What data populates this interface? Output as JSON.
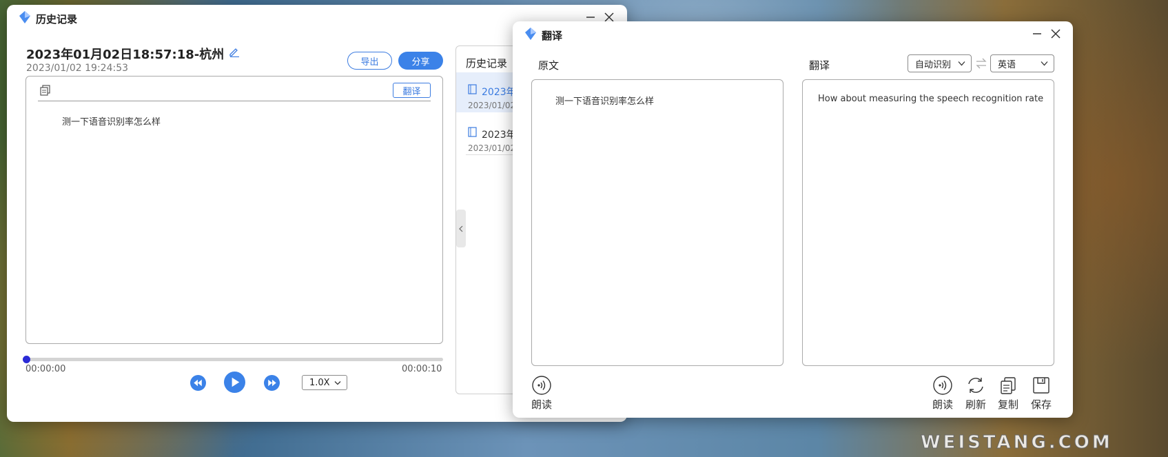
{
  "history_window": {
    "title": "历史记录",
    "record_title": "2023年01月02日18:57:18-杭州",
    "record_datetime": "2023/01/02 19:24:53",
    "export_label": "导出",
    "share_label": "分享",
    "translate_label": "翻译",
    "transcript": "测一下语音识别率怎么样",
    "player": {
      "current_time": "00:00:00",
      "total_time": "00:00:10",
      "progress": 0,
      "speed": "1.0X"
    },
    "sidebar": {
      "title": "历史记录",
      "items": [
        {
          "title": "2023年",
          "date": "2023/01/02",
          "selected": true
        },
        {
          "title": "2023年",
          "date": "2023/01/02",
          "selected": false
        }
      ]
    }
  },
  "translate_window": {
    "title": "翻译",
    "source_label": "原文",
    "target_label": "翻译",
    "source_lang": "自动识别",
    "target_lang": "英语",
    "source_text": "测一下语音识别率怎么样",
    "target_text": "How about measuring the speech recognition rate",
    "read_label": "朗读",
    "tools": [
      "朗读",
      "刷新",
      "复制",
      "保存"
    ]
  },
  "watermark": "WEISTANG.COM",
  "colors": {
    "accent": "#3b82e8",
    "selected_row": "#e6eefb",
    "progress_dot": "#2b2bd6"
  }
}
